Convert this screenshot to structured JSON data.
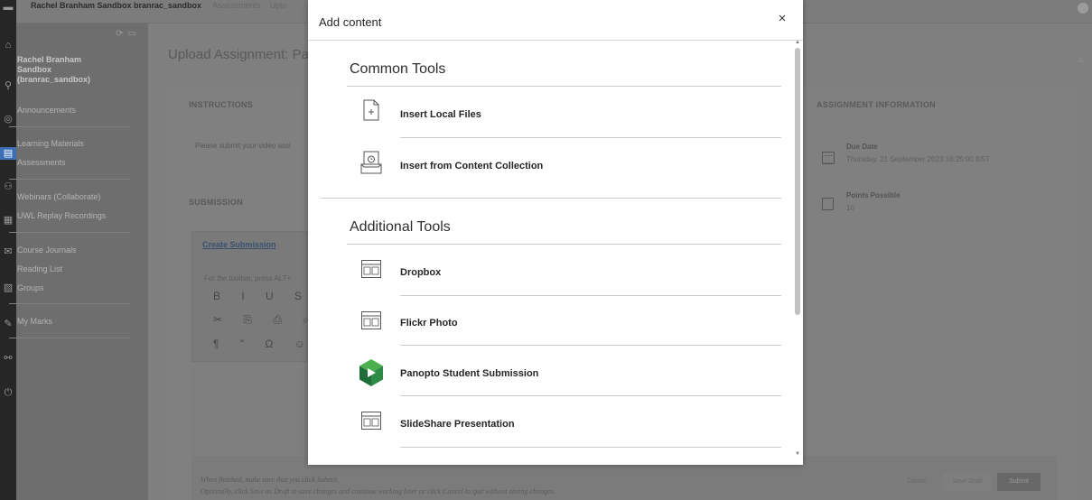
{
  "window": {
    "breadcrumb": {
      "course": "Rachel Branham Sandbox branrac_sandbox",
      "section": "Assessments",
      "page": "Uplo"
    }
  },
  "sidebar": {
    "course_title": "Rachel Branham Sandbox (branrac_sandbox)",
    "items": [
      {
        "label": "Announcements"
      },
      {
        "label": "Learning Materials"
      },
      {
        "label": "Assessments"
      },
      {
        "label": "Webinars (Collaborate)"
      },
      {
        "label": "UWL Replay Recordings"
      },
      {
        "label": "Course Journals"
      },
      {
        "label": "Reading List"
      },
      {
        "label": "Groups"
      },
      {
        "label": "My Marks"
      }
    ]
  },
  "main": {
    "page_title": "Upload Assignment: Panc",
    "instructions_label": "INSTRUCTIONS",
    "instructions_text": "Please submit your video assi",
    "submission_label": "SUBMISSION",
    "create_submission": "Create Submission",
    "toolbar_hint": "For the toolbar, press ALT+",
    "toolbar_row1": "B I U S ≡",
    "toolbar_row2": "✂ ⎘ ⎙ ⌕ ↶",
    "toolbar_row3": "¶ \" Ω ☺ ▮",
    "assignment_info_label": "ASSIGNMENT INFORMATION",
    "due_date_label": "Due Date",
    "due_date_value": "Thursday, 21 September 2023 16:25:00 BST",
    "points_label": "Points Possible",
    "points_value": "10",
    "footer_note1": "When finished, make sure that you click Submit.",
    "footer_note2": "Optionally, click Save as Draft to save changes and continue working later or click Cancel to quit without saving changes.",
    "buttons": {
      "cancel": "Cancel",
      "save_draft": "Save Draft",
      "submit": "Submit"
    }
  },
  "modal": {
    "title": "Add content",
    "close_glyph": "×",
    "common_tools_heading": "Common Tools",
    "common_tools": [
      {
        "label": "Insert Local Files",
        "icon": "file-icon"
      },
      {
        "label": "Insert from Content Collection",
        "icon": "content-collection-icon"
      }
    ],
    "additional_tools_heading": "Additional Tools",
    "additional_tools": [
      {
        "label": "Dropbox",
        "icon": "browser-window-icon"
      },
      {
        "label": "Flickr Photo",
        "icon": "browser-window-icon"
      },
      {
        "label": "Panopto Student Submission",
        "icon": "panopto-icon"
      },
      {
        "label": "SlideShare Presentation",
        "icon": "browser-window-icon"
      }
    ]
  },
  "colors": {
    "overlay": "#7f7f7f",
    "modal_bg": "#ffffff",
    "panopto_green_dark": "#1f6b3a",
    "panopto_green_light": "#4caf50"
  }
}
